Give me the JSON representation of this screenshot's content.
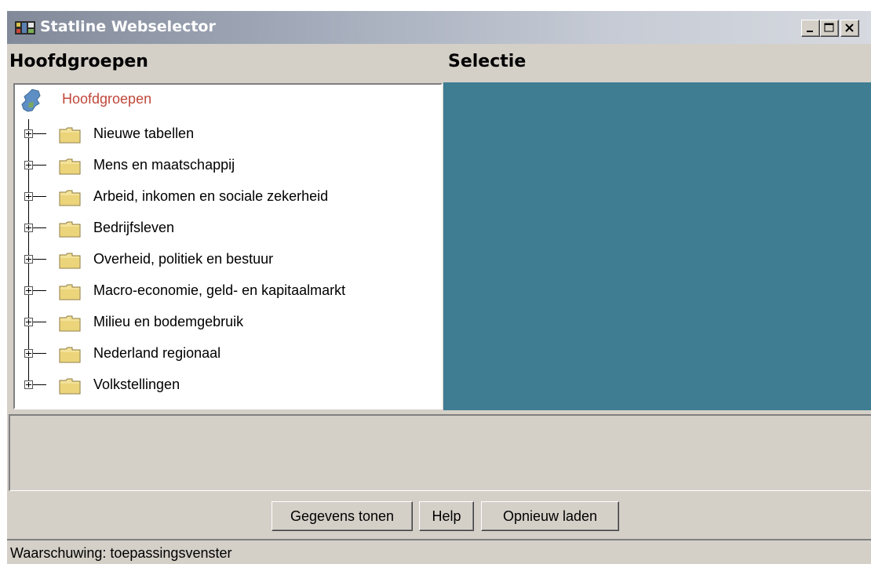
{
  "window": {
    "title": "Statline Webselector",
    "title_icon": "film-strip-icon",
    "controls": [
      "minimize-icon",
      "maximize-icon",
      "close-icon"
    ]
  },
  "panes": {
    "left_header": "Hoofdgroepen",
    "right_header": "Selectie"
  },
  "tree": {
    "root_label": "Hoofdgroepen",
    "root_icon": "netherlands-map-icon",
    "items": [
      {
        "label": "Nieuwe tabellen"
      },
      {
        "label": "Mens en maatschappij"
      },
      {
        "label": "Arbeid, inkomen en sociale zekerheid"
      },
      {
        "label": "Bedrijfsleven"
      },
      {
        "label": "Overheid, politiek en bestuur"
      },
      {
        "label": "Macro-economie, geld- en kapitaalmarkt"
      },
      {
        "label": "Milieu en bodemgebruik"
      },
      {
        "label": "Nederland regionaal"
      },
      {
        "label": "Volkstellingen"
      }
    ]
  },
  "colors": {
    "selection_pane": "#3f7d93",
    "root_label": "#c0483a",
    "face": "#d4d0c8"
  },
  "buttons": {
    "show_data": "Gegevens tonen",
    "help": "Help",
    "reload": "Opnieuw laden"
  },
  "status": {
    "text": "Waarschuwing: toepassingsvenster"
  }
}
